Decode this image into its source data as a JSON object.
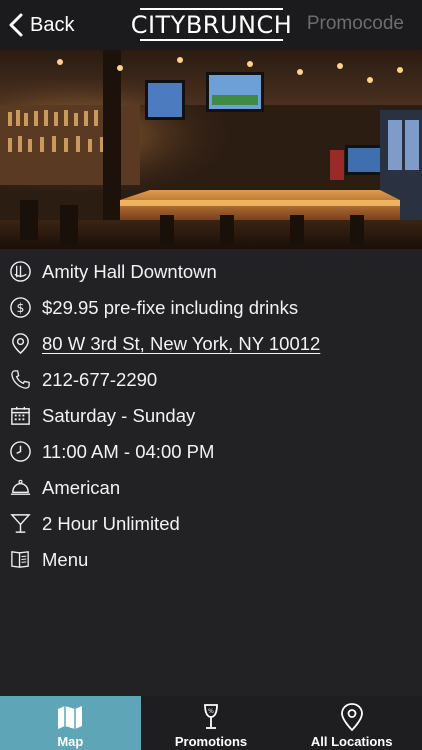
{
  "nav": {
    "back_label": "Back",
    "logo_text": "CITYBRUNCH",
    "promo_label": "Promocode"
  },
  "hero": {
    "icon": "restaurant-bar-photo"
  },
  "details": [
    {
      "icon": "plate-icon",
      "text": "Amity Hall Downtown",
      "link": false
    },
    {
      "icon": "dollar-icon",
      "text": "$29.95 pre-fixe including drinks",
      "link": false
    },
    {
      "icon": "pin-icon",
      "text": "80 W 3rd St, New York, NY 10012",
      "link": true
    },
    {
      "icon": "phone-icon",
      "text": "212-677-2290",
      "link": false
    },
    {
      "icon": "calendar-icon",
      "text": "Saturday - Sunday",
      "link": false
    },
    {
      "icon": "clock-icon",
      "text": "11:00 AM - 04:00 PM",
      "link": false
    },
    {
      "icon": "cloche-icon",
      "text": "American",
      "link": false
    },
    {
      "icon": "cocktail-icon",
      "text": "2 Hour Unlimited",
      "link": false
    },
    {
      "icon": "menu-book-icon",
      "text": "Menu",
      "link": false
    }
  ],
  "tabs": [
    {
      "label": "Map",
      "icon": "map-icon",
      "active": true
    },
    {
      "label": "Promotions",
      "icon": "wine-glass-icon",
      "active": false
    },
    {
      "label": "All Locations",
      "icon": "location-pin-icon",
      "active": false
    }
  ],
  "colors": {
    "background": "#222224",
    "active_tab": "#5ea6b7",
    "promo_text": "#6d6d70"
  }
}
